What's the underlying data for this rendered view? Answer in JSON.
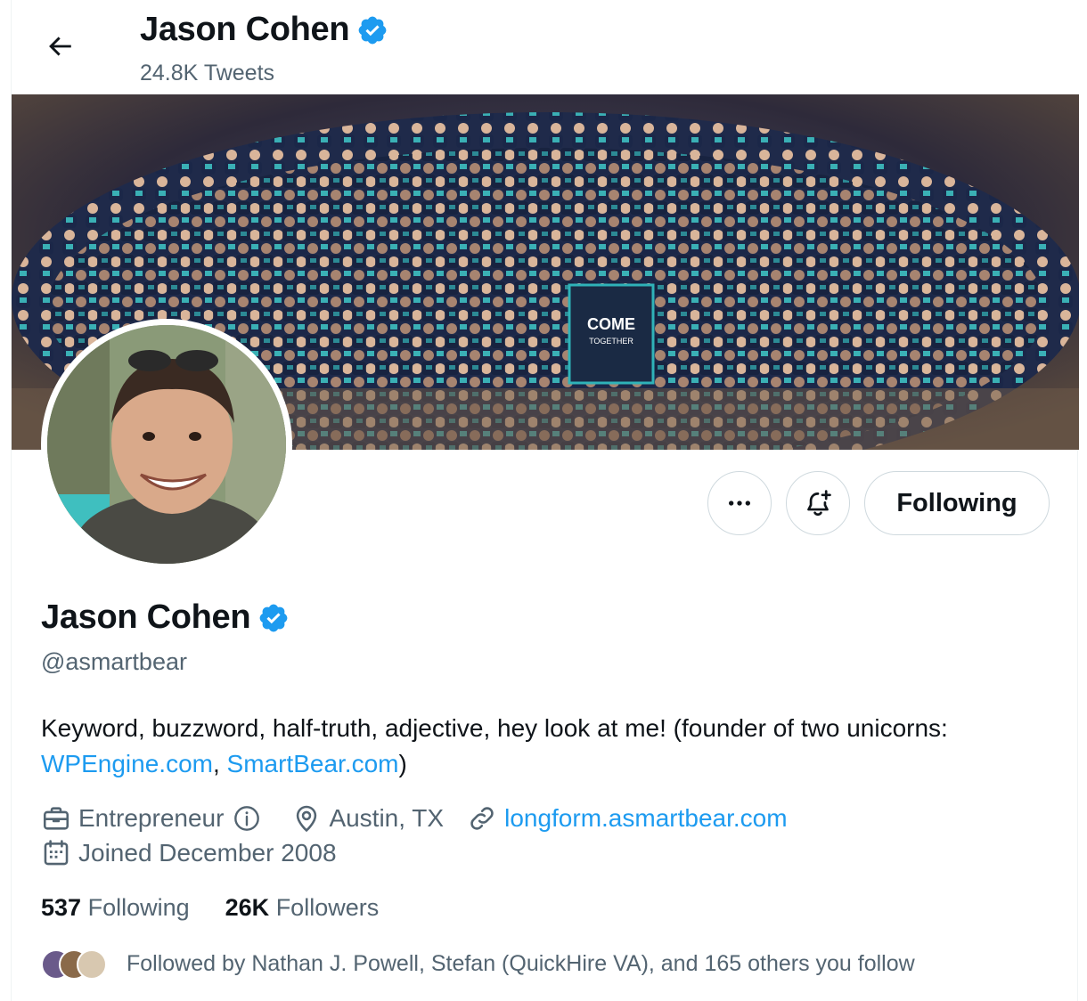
{
  "header": {
    "name": "Jason Cohen",
    "tweet_count": "24.8K Tweets",
    "back_icon": "arrow-left-icon",
    "verified_icon": "verified-badge-icon"
  },
  "banner": {
    "sign_text": "COME",
    "sign_text_small": "TOGETHER"
  },
  "actions": {
    "more_icon": "more-dots-icon",
    "notify_icon": "bell-plus-icon",
    "following_label": "Following"
  },
  "profile": {
    "name": "Jason Cohen",
    "handle": "@asmartbear",
    "bio_text": "Keyword, buzzword, half-truth, adjective, hey look at me! (founder of two unicorns: ",
    "bio_link1": "WPEngine.com",
    "bio_sep": ", ",
    "bio_link2": "SmartBear.com",
    "bio_end": ")",
    "job": "Entrepreneur",
    "location": "Austin, TX",
    "website": "longform.asmartbear.com",
    "joined": "Joined December 2008"
  },
  "stats": {
    "following_count": "537",
    "following_label": "Following",
    "followers_count": "26K",
    "followers_label": "Followers"
  },
  "followed_by": {
    "text": "Followed by Nathan J. Powell, Stefan (QuickHire VA), and 165 others you follow"
  },
  "colors": {
    "accent": "#1d9bf0",
    "secondary_text": "#536471",
    "primary_text": "#0f1419",
    "border": "#cfd9de"
  }
}
